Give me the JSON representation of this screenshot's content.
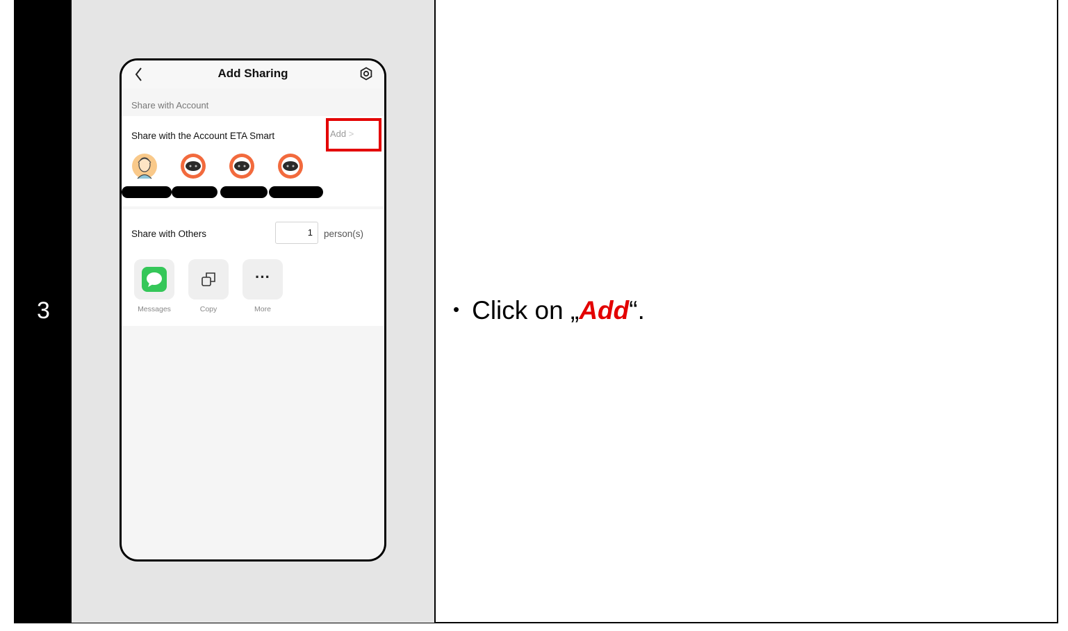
{
  "step": {
    "number": "3"
  },
  "instruction": {
    "bullet": "•",
    "prefix": "Click on „",
    "keyword": "Add",
    "suffix": "“."
  },
  "phone": {
    "header": {
      "back_icon": "chevron-left-icon",
      "title": "Add Sharing",
      "settings_icon": "settings-icon"
    },
    "share_with_account": {
      "section_label": "Share with Account",
      "row_label": "Share with the Account ETA Smart",
      "add_label": "Add",
      "add_chevron": ">",
      "highlight_color": "#e30000"
    },
    "share_with_others": {
      "label": "Share with Others",
      "count": "1",
      "count_suffix": "person(s)",
      "options": [
        {
          "label": "Messages",
          "icon": "message-bubble-icon",
          "color": "#35c759"
        },
        {
          "label": "Copy",
          "icon": "copy-icon"
        },
        {
          "label": "More",
          "icon": "more-dots-icon",
          "glyph": "···"
        }
      ]
    }
  },
  "colors": {
    "accent_red": "#e30000",
    "robot_orange": "#f26a3d"
  }
}
